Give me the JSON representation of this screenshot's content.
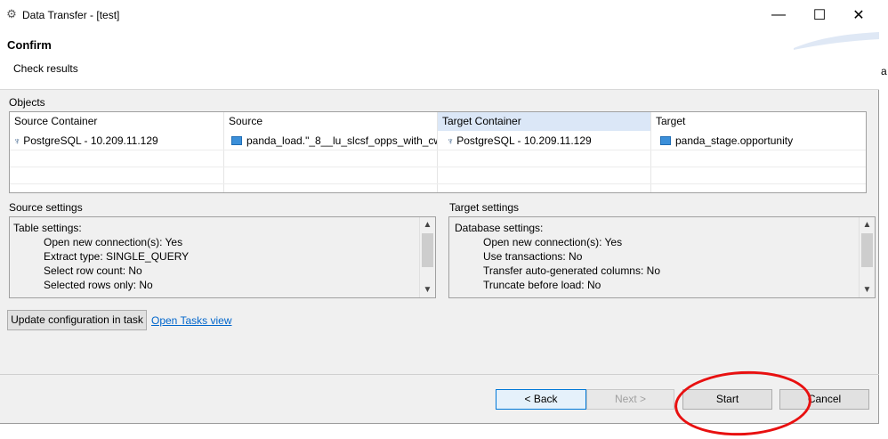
{
  "window": {
    "title": "Data Transfer - [test]",
    "minimize_glyph": "—",
    "maximize_glyph": "☐",
    "close_glyph": "✕"
  },
  "header": {
    "title": "Confirm",
    "subtitle": "Check results"
  },
  "objects": {
    "label": "Objects",
    "columns": [
      "Source Container",
      "Source",
      "Target Container",
      "Target"
    ],
    "rows": [
      {
        "source_container": "PostgreSQL - 10.209.11.129",
        "source": "panda_load.\"_8__lu_slcsf_opps_with_cw_...",
        "target_container": "PostgreSQL - 10.209.11.129",
        "target": "panda_stage.opportunity"
      }
    ]
  },
  "source_settings": {
    "label": "Source settings",
    "heading": "Table settings:",
    "lines": [
      "Open new connection(s): Yes",
      "Extract type: SINGLE_QUERY",
      "Select row count: No",
      "Selected rows only: No"
    ]
  },
  "target_settings": {
    "label": "Target settings",
    "heading": "Database settings:",
    "lines": [
      "Open new connection(s): Yes",
      "Use transactions: No",
      "Transfer auto-generated columns: No",
      "Truncate before load: No"
    ]
  },
  "actions": {
    "update_config": "Update configuration in task",
    "open_tasks": "Open Tasks view"
  },
  "footer": {
    "back": "< Back",
    "next": "Next >",
    "start": "Start",
    "cancel": "Cancel"
  },
  "background_text": "a",
  "icons": {
    "app": "gear-icon",
    "postgres": "elephant-icon",
    "table": "table-icon"
  },
  "colors": {
    "accent": "#0078d7",
    "link": "#0066cc",
    "selected_header": "#dbe7f7",
    "annotation": "#e81010"
  }
}
